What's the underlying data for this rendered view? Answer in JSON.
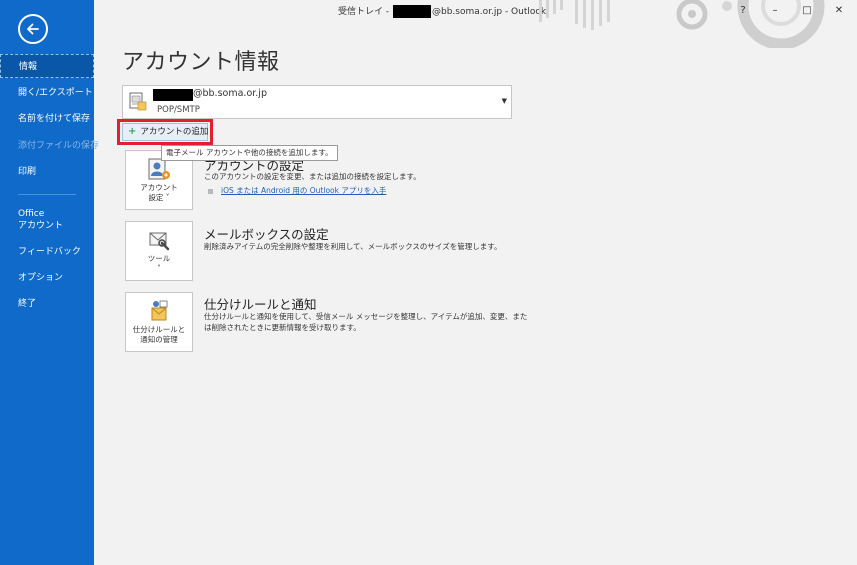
{
  "titlebar": {
    "prefix": "受信トレイ - ",
    "email_suffix": "@bb.soma.or.jp",
    "app": " - Outlook",
    "help": "?",
    "minimize": "–",
    "restore": "□",
    "close": "✕"
  },
  "sidebar": {
    "items": [
      {
        "label": "情報"
      },
      {
        "label": "開く/エクスポート"
      },
      {
        "label": "名前を付けて保存"
      },
      {
        "label": "添付ファイルの保存"
      },
      {
        "label": "印刷"
      },
      {
        "label_line1": "Office",
        "label_line2": "アカウント"
      },
      {
        "label": "フィードバック"
      },
      {
        "label": "オプション"
      },
      {
        "label": "終了"
      }
    ]
  },
  "main": {
    "title": "アカウント情報",
    "account": {
      "email_suffix": "@bb.soma.or.jp",
      "type": "POP/SMTP"
    },
    "add_account_label": "アカウントの追加",
    "tooltip": "電子メール アカウントや他の接続を追加します。",
    "sections": [
      {
        "button_line1": "アカウント",
        "button_line2": "設定 ˅",
        "title": "アカウントの設定",
        "desc": "このアカウントの設定を変更、または追加の接続を設定します。",
        "link": "iOS または Android 用の Outlook アプリを入手"
      },
      {
        "button_line1": "ツール",
        "button_line2": "˅",
        "title": "メールボックスの設定",
        "desc": "削除済みアイテムの完全削除や整理を利用して、メールボックスのサイズを管理します。"
      },
      {
        "button_line1": "仕分けルールと",
        "button_line2": "通知の管理",
        "title": "仕分けルールと通知",
        "desc_line1": "仕分けルールと通知を使用して、受信メール メッセージを整理し、アイテムが追加、変更、また",
        "desc_line2": "は削除されたときに更新情報を受け取ります。"
      }
    ]
  },
  "colors": {
    "sidebar": "#0f6ac9",
    "highlight": "#e0202e",
    "link": "#1f5fb4"
  }
}
